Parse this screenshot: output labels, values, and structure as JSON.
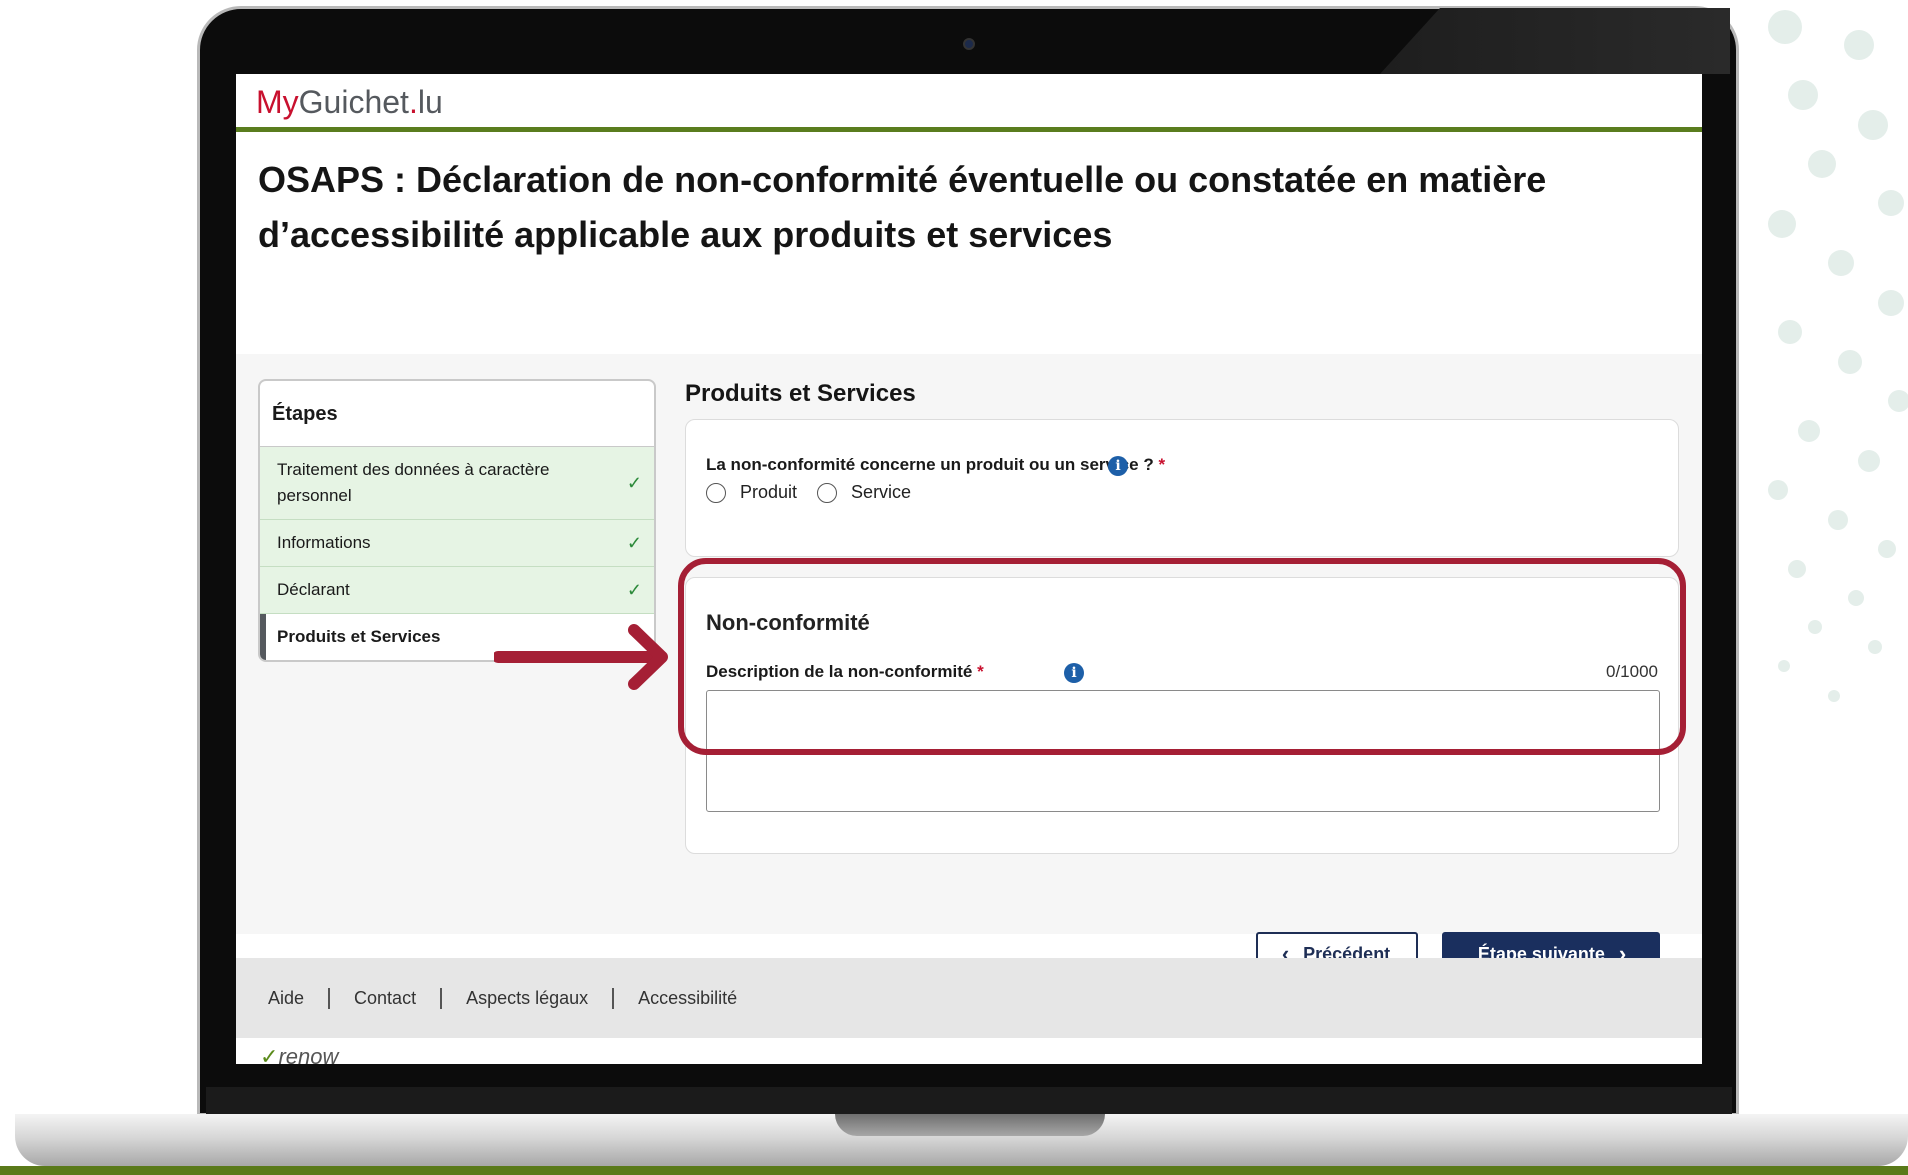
{
  "brand": {
    "my": "My",
    "guichet": "Guichet",
    "dot": ".",
    "lu": "lu"
  },
  "page_title": "OSAPS : Déclaration de non-conformité éventuelle ou constatée en matière d’accessibilité applicable aux produits et services",
  "steps": {
    "title": "Étapes",
    "items": [
      {
        "label": "Traitement des données à caractère personnel",
        "done": true
      },
      {
        "label": "Informations",
        "done": true
      },
      {
        "label": "Déclarant",
        "done": true
      },
      {
        "label": "Produits et Services",
        "done": false,
        "current": true
      }
    ],
    "check_glyph": "✓"
  },
  "section": {
    "heading": "Produits et Services"
  },
  "question": {
    "label": "La non-conformité concerne un produit ou un service ?",
    "required_mark": "*",
    "options": [
      "Produit",
      "Service"
    ]
  },
  "nonconformity": {
    "heading": "Non-conformité",
    "description_label": "Description de la non-conformité",
    "required_mark": "*",
    "counter": "0/1000",
    "value": ""
  },
  "buttons": {
    "previous": "Précédent",
    "next": "Étape suivante"
  },
  "footer": {
    "links": [
      "Aide",
      "Contact",
      "Aspects légaux",
      "Accessibilité"
    ]
  },
  "renow": "renow",
  "icons": {
    "info": "info-icon",
    "check": "check-icon",
    "chevron_left": "chevron-left-icon",
    "chevron_right": "chevron-right-icon"
  },
  "colors": {
    "accent_red": "#a51f35",
    "brand_red": "#c8102e",
    "green": "#5a7d1e",
    "navy": "#1a2f5e",
    "info_blue": "#1d5fa8"
  }
}
